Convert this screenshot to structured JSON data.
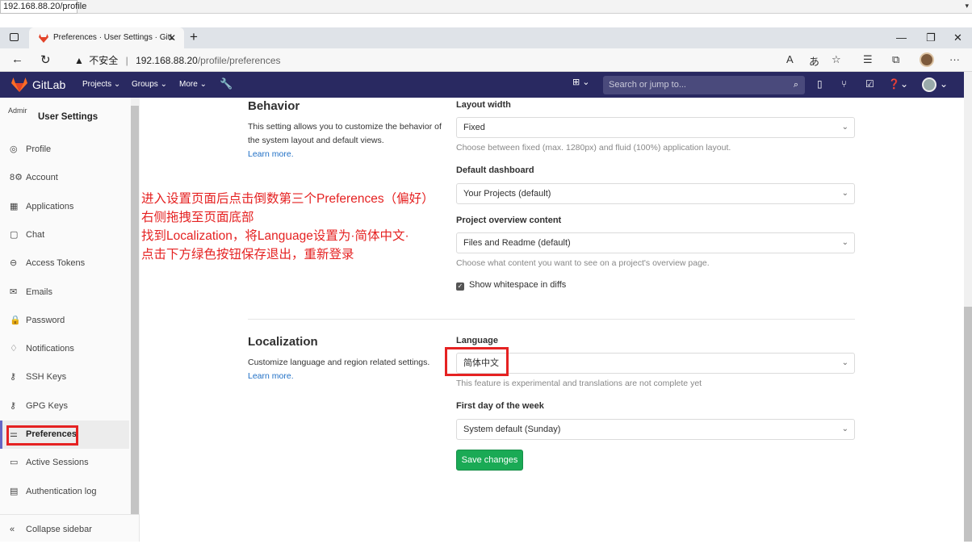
{
  "outer": {
    "url": "192.168.88.20/profile"
  },
  "browser": {
    "tab_title": "Preferences · User Settings · GitL",
    "security_label": "不安全",
    "url_host": "192.168.88.20",
    "url_path": "/profile/preferences"
  },
  "gitlab_nav": {
    "brand": "GitLab",
    "menus": [
      "Projects",
      "Groups",
      "More"
    ],
    "search_placeholder": "Search or jump to..."
  },
  "sidebar": {
    "avatar_alt": "Admir",
    "title": "User Settings",
    "items": [
      {
        "label": "Profile",
        "icon": "profile-icon",
        "glyph": "◎"
      },
      {
        "label": "Account",
        "icon": "account-icon",
        "glyph": "8⚙"
      },
      {
        "label": "Applications",
        "icon": "applications-icon",
        "glyph": "▦"
      },
      {
        "label": "Chat",
        "icon": "chat-icon",
        "glyph": "▢"
      },
      {
        "label": "Access Tokens",
        "icon": "token-icon",
        "glyph": "⊖"
      },
      {
        "label": "Emails",
        "icon": "email-icon",
        "glyph": "✉"
      },
      {
        "label": "Password",
        "icon": "lock-icon",
        "glyph": "🔒"
      },
      {
        "label": "Notifications",
        "icon": "bell-icon",
        "glyph": "♢"
      },
      {
        "label": "SSH Keys",
        "icon": "key-icon",
        "glyph": "⚷"
      },
      {
        "label": "GPG Keys",
        "icon": "key-icon",
        "glyph": "⚷"
      },
      {
        "label": "Preferences",
        "icon": "preferences-icon",
        "glyph": "⚌"
      },
      {
        "label": "Active Sessions",
        "icon": "monitor-icon",
        "glyph": "▭"
      },
      {
        "label": "Authentication log",
        "icon": "log-icon",
        "glyph": "▤"
      }
    ],
    "collapse_label": "Collapse sidebar"
  },
  "annotation": {
    "lines": [
      "进入设置页面后点击倒数第三个Preferences（偏好）",
      "右侧拖拽至页面底部",
      "找到Localization，将Language设置为·简体中文·",
      "点击下方绿色按钮保存退出，重新登录"
    ]
  },
  "behavior": {
    "title": "Behavior",
    "description": "This setting allows you to customize the behavior of the system layout and default views.",
    "learn_more": "Learn more.",
    "layout_width_label": "Layout width",
    "layout_width_value": "Fixed",
    "layout_width_hint": "Choose between fixed (max. 1280px) and fluid (100%) application layout.",
    "dashboard_label": "Default dashboard",
    "dashboard_value": "Your Projects (default)",
    "overview_label": "Project overview content",
    "overview_value": "Files and Readme (default)",
    "overview_hint": "Choose what content you want to see on a project's overview page.",
    "whitespace_label": "Show whitespace in diffs"
  },
  "localization": {
    "title": "Localization",
    "description": "Customize language and region related settings.",
    "learn_more": "Learn more.",
    "language_label": "Language",
    "language_value": "简体中文",
    "language_hint": "This feature is experimental and translations are not complete yet",
    "first_day_label": "First day of the week",
    "first_day_value": "System default (Sunday)"
  },
  "save_label": "Save changes",
  "colors": {
    "nav_bg": "#292961",
    "save_green": "#1aaa55",
    "highlight_red": "#e52222",
    "link_blue": "#1f6fc5"
  }
}
